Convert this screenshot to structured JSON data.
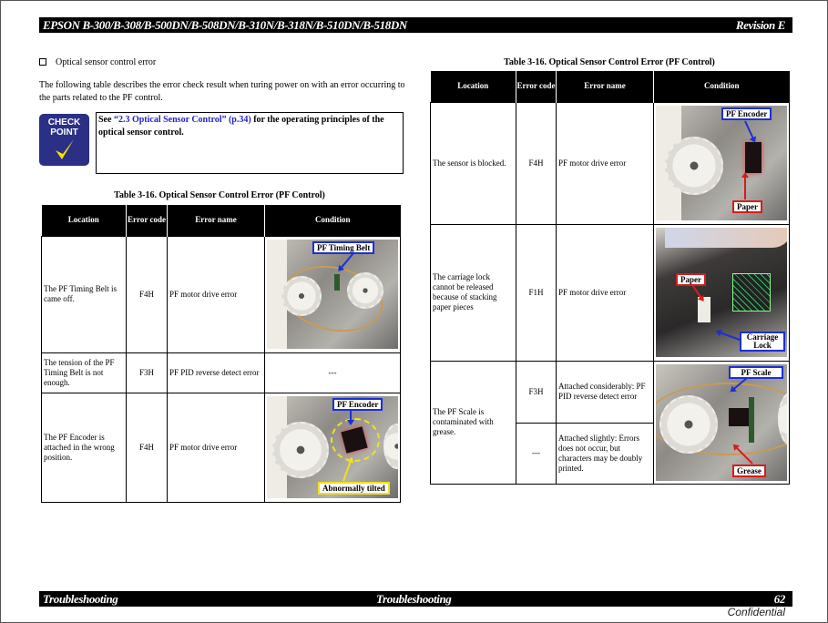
{
  "header": {
    "title": "EPSON B-300/B-308/B-500DN/B-508DN/B-310N/B-318N/B-510DN/B-518DN",
    "revision": "Revision E"
  },
  "section": {
    "title": "Optical sensor control error",
    "intro": "The following table describes the error check result when turing power on with an error occurring to the parts related to the PF control."
  },
  "checkpoint": {
    "badge_line1": "CHECK",
    "badge_line2": "POINT",
    "text_prefix": "See ",
    "link": "“2.3 Optical Sensor Control” (p.34)",
    "text_suffix": " for the operating principles of the optical sensor control."
  },
  "table_headers": {
    "location": "Location",
    "error_code": "Error code",
    "error_name": "Error name",
    "condition": "Condition"
  },
  "left_table": {
    "caption": "Table 3-16.  Optical Sensor Control Error (PF Control)",
    "rows": [
      {
        "location": "The PF Timing Belt is came off.",
        "code": "F4H",
        "name": "PF motor drive error",
        "condition": "",
        "labels": [
          "PF Timing Belt"
        ]
      },
      {
        "location": "The tension of the PF Timing Belt is not enough.",
        "code": "F3H",
        "name": "PF PID reverse detect error",
        "condition": "---"
      },
      {
        "location": "The PF Encoder is attached in the wrong position.",
        "code": "F4H",
        "name": "PF motor drive error",
        "condition": "",
        "labels": [
          "PF Encoder",
          "Abnormally tilted"
        ]
      }
    ]
  },
  "right_table": {
    "caption": "Table 3-16.  Optical Sensor Control Error (PF Control)",
    "rows": [
      {
        "location": "The sensor is blocked.",
        "code": "F4H",
        "name": "PF motor drive error",
        "labels": [
          "PF Encoder",
          "Paper"
        ]
      },
      {
        "location": "The carriage lock cannot be released because of stacking paper pieces",
        "code": "F1H",
        "name": "PF motor drive error",
        "labels": [
          "Paper",
          "Carriage Lock"
        ]
      },
      {
        "location": "The PF Scale is contaminated with grease.",
        "labels": [
          "PF Scale",
          "Grease"
        ],
        "sub": [
          {
            "code": "F3H",
            "name": "Attached considerably: PF PID reverse detect error"
          },
          {
            "code": "---",
            "name": "Attached slightly: Errors does not occur, but characters may be doubly printed."
          }
        ]
      }
    ]
  },
  "footer": {
    "left": "Troubleshooting",
    "center": "Troubleshooting",
    "page": "62",
    "confidential": "Confidential"
  }
}
